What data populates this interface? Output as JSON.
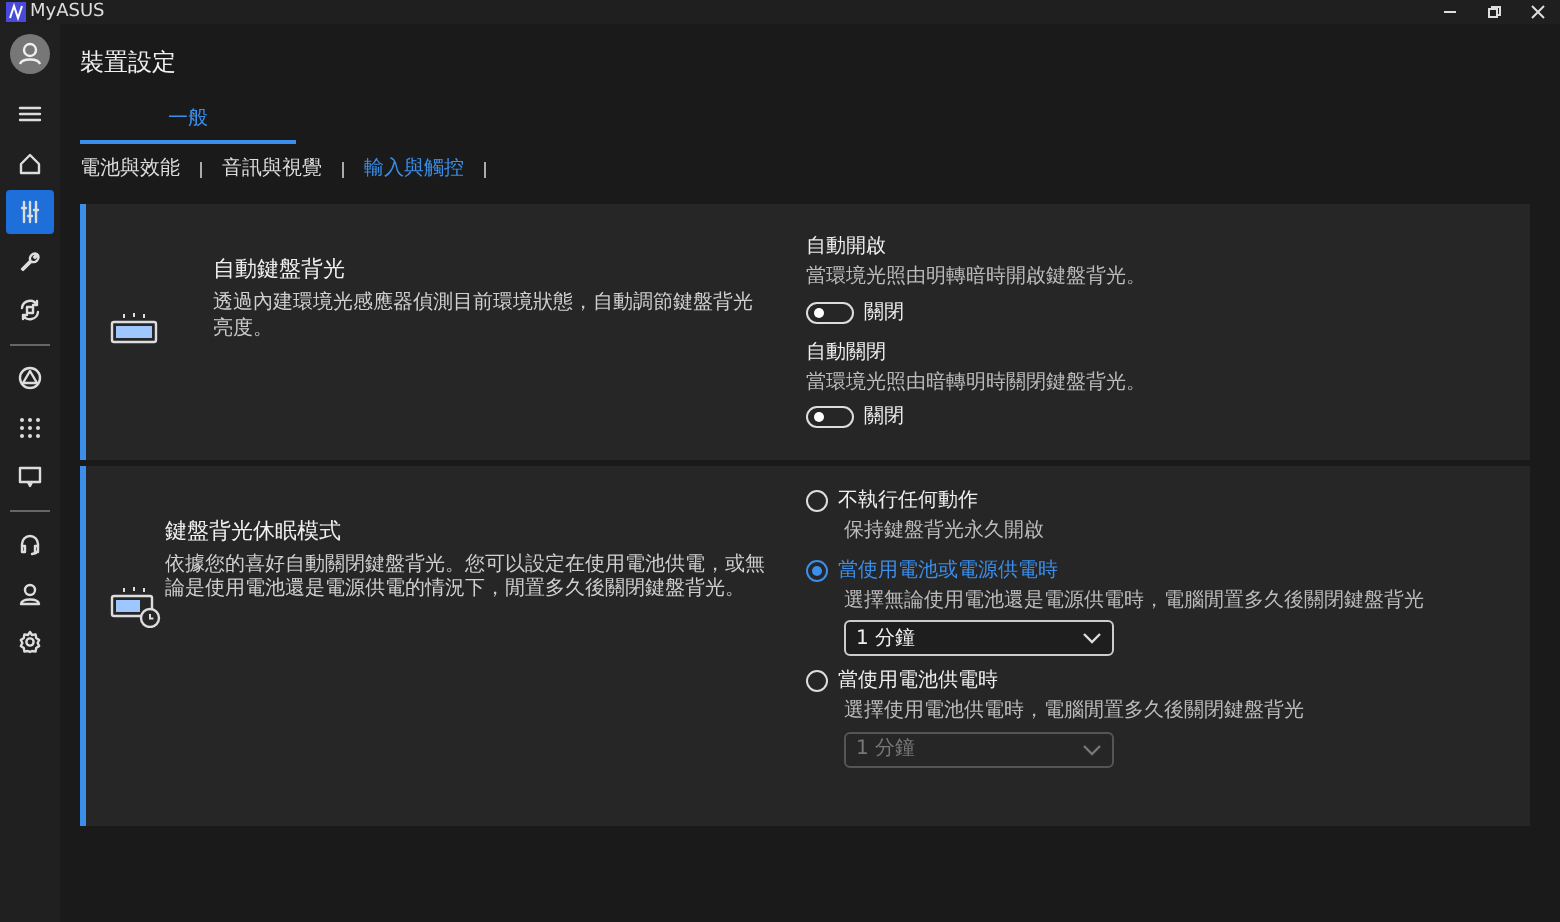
{
  "window": {
    "title": "MyASUS"
  },
  "sidebar": {
    "groups": [
      {
        "items": [
          {
            "kind": "menu",
            "selected": false
          },
          {
            "kind": "home",
            "selected": false
          },
          {
            "kind": "sliders",
            "selected": true
          },
          {
            "kind": "wrench",
            "selected": false
          },
          {
            "kind": "sync",
            "selected": false
          }
        ]
      },
      {
        "items": [
          {
            "kind": "triangle",
            "selected": false
          },
          {
            "kind": "apps",
            "selected": false
          },
          {
            "kind": "screen",
            "selected": false
          }
        ]
      },
      {
        "items": [
          {
            "kind": "headset",
            "selected": false
          },
          {
            "kind": "person",
            "selected": false
          },
          {
            "kind": "gear",
            "selected": false
          }
        ]
      }
    ]
  },
  "page_title": "裝置設定",
  "tabs": [
    {
      "label": "一般",
      "selected": true
    }
  ],
  "subtabs": [
    {
      "label": "電池與效能",
      "selected": false
    },
    {
      "label": "音訊與視覺",
      "selected": false
    },
    {
      "label": "輸入與觸控",
      "selected": true
    }
  ],
  "cards": [
    {
      "kind": "backlight",
      "title": "自動鍵盤背光",
      "description": "透過內建環境光感應器偵測目前環境狀態，自動調節鍵盤背光亮度。",
      "settings": [
        {
          "kind": "toggle",
          "label": "自動開啟",
          "description": "當環境光照由明轉暗時開啟鍵盤背光。",
          "on": false,
          "state_text": "關閉"
        },
        {
          "kind": "toggle",
          "label": "自動關閉",
          "description": "當環境光照由暗轉明時關閉鍵盤背光。",
          "on": false,
          "state_text": "關閉"
        }
      ]
    },
    {
      "kind": "sleep",
      "title": "鍵盤背光休眠模式",
      "description": "依據您的喜好自動關閉鍵盤背光。您可以設定在使用電池供電，或無論是使用電池還是電源供電的情況下，閒置多久後關閉鍵盤背光。",
      "settings": [
        {
          "kind": "radio",
          "label": "不執行任何動作",
          "description": "保持鍵盤背光永久開啟",
          "selected": false
        },
        {
          "kind": "radio",
          "label": "當使用電池或電源供電時",
          "description": "選擇無論使用電池還是電源供電時，電腦閒置多久後關閉鍵盤背光",
          "selected": true,
          "dropdown": {
            "value": "1 分鐘",
            "disabled": false
          }
        },
        {
          "kind": "radio",
          "label": "當使用電池供電時",
          "description": "選擇使用電池供電時，電腦閒置多久後關閉鍵盤背光",
          "selected": false,
          "dropdown": {
            "value": "1 分鐘",
            "disabled": true
          }
        }
      ]
    }
  ]
}
